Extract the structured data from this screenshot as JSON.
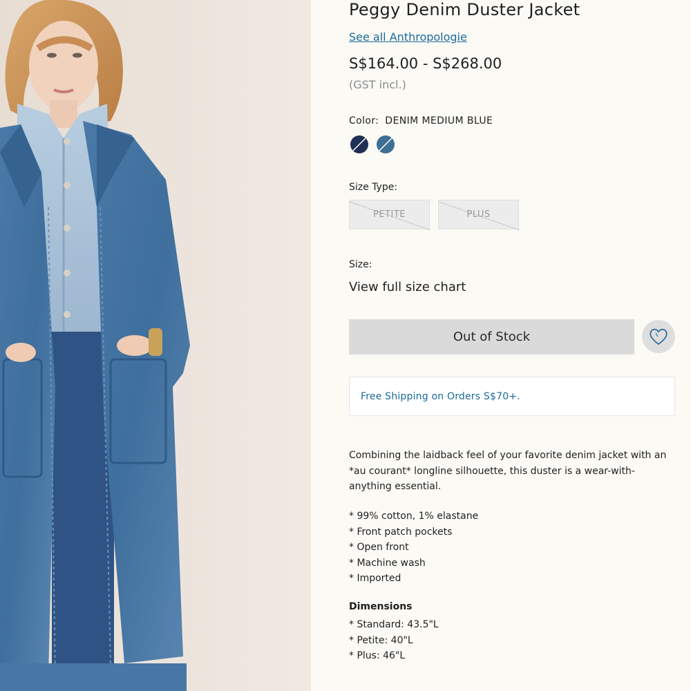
{
  "product": {
    "title": "Peggy Denim Duster Jacket",
    "brand_link": "See all Anthropologie",
    "price": "S$164.00 - S$268.00",
    "tax_note": "(GST incl.)"
  },
  "color": {
    "label": "Color:",
    "value": "DENIM MEDIUM BLUE",
    "swatches": [
      {
        "name": "denim-dark",
        "color": "#1f2f55"
      },
      {
        "name": "denim-medium-blue",
        "color": "#3f6f93"
      }
    ]
  },
  "size_type": {
    "label": "Size Type:",
    "options": [
      "PETITE",
      "PLUS"
    ]
  },
  "size": {
    "label": "Size:",
    "chart_link": "View full size chart"
  },
  "actions": {
    "stock_button": "Out of Stock",
    "wishlist_icon": "heart-icon"
  },
  "shipping": {
    "text": "Free Shipping on Orders S$70+."
  },
  "description": {
    "text": "Combining the laidback feel of your favorite denim jacket with an *au courant* longline silhouette, this duster is a wear-with-anything essential.",
    "bullets": [
      "* 99% cotton, 1% elastane",
      "* Front patch pockets",
      "* Open front",
      "* Machine wash",
      "* Imported"
    ],
    "dimensions_title": "Dimensions",
    "dimensions": [
      "* Standard: 43.5\"L",
      "* Petite: 40\"L",
      "* Plus: 46\"L"
    ]
  },
  "colors": {
    "link": "#1a6a9a",
    "background": "#fbfaf5",
    "disabled_button": "#dadada"
  }
}
